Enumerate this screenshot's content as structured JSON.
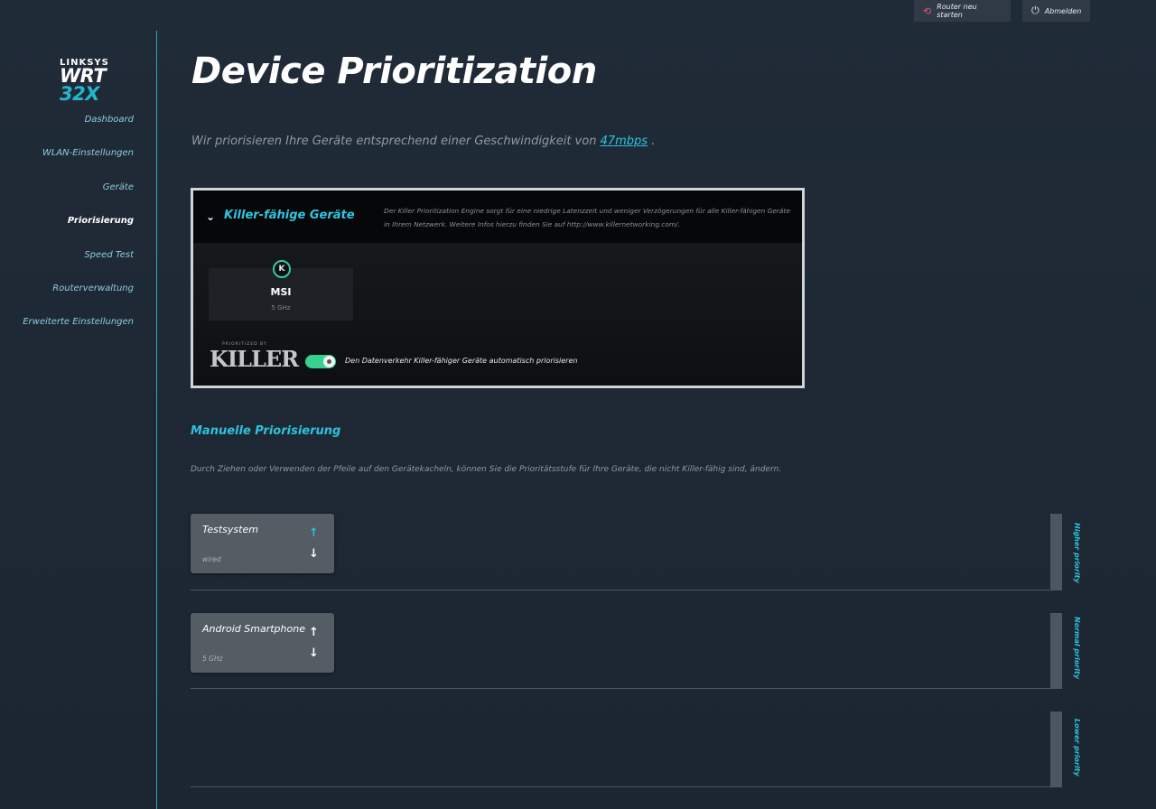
{
  "topbar": {
    "restart_label": "Router neu starten",
    "logout_label": "Abmelden",
    "restart_icon": "restart-icon",
    "logout_icon": "power-icon"
  },
  "logo": {
    "brand": "LINKSYS",
    "model_prefix": "WRT ",
    "model_num": "32X"
  },
  "sidebar": {
    "items": [
      {
        "label": "Dashboard"
      },
      {
        "label": "WLAN-Einstellungen"
      },
      {
        "label": "Geräte"
      },
      {
        "label": "Priorisierung"
      },
      {
        "label": "Speed Test"
      },
      {
        "label": "Routerverwaltung"
      },
      {
        "label": "Erweiterte Einstellungen"
      }
    ],
    "active": "Priorisierung"
  },
  "page": {
    "title": "Device Prioritization",
    "subtitle_prefix": "Wir priorisieren Ihre Geräte entsprechend einer Geschwindigkeit von",
    "speed_link": "47mbps",
    "subtitle_suffix": " ."
  },
  "killer": {
    "title": "Killer-fähige Geräte",
    "description": "Der Killer Prioritization Engine sorgt für eine niedrige Latenzzeit und weniger Verzögerungen für alle Killer-fähigen Geräte in Ihrem Netzwerk. Weitere Infos hierzu finden Sie auf http://www.killernetworking.com/.",
    "device": {
      "name": "MSI",
      "band": "5 GHz",
      "icon": "K"
    },
    "logo_small": "PRIORITIZED BY",
    "logo_big": "KILLER",
    "toggle_on": true,
    "toggle_label": "Den Datenverkehr Killer-fähiger Geräte automatisch priorisieren"
  },
  "manual": {
    "title": "Manuelle Priorisierung",
    "description": "Durch Ziehen oder Verwenden der Pfeile auf den Gerätekacheln, können Sie die Prioritätsstufe für Ihre Geräte, die nicht Killer-fähig sind, ändern.",
    "lanes": [
      {
        "label": "Higher priority",
        "devices": [
          {
            "name": "Testsystem",
            "type": "wired"
          }
        ]
      },
      {
        "label": "Normal priority",
        "devices": [
          {
            "name": "Android Smartphone",
            "type": "5 GHz"
          }
        ]
      },
      {
        "label": "Lower priority",
        "devices": []
      }
    ],
    "up_arrow": "↑",
    "down_arrow": "↓"
  },
  "colors": {
    "accent": "#2cc2dd",
    "toggle": "#38d08f",
    "restart_icon": "#e85a6a"
  }
}
